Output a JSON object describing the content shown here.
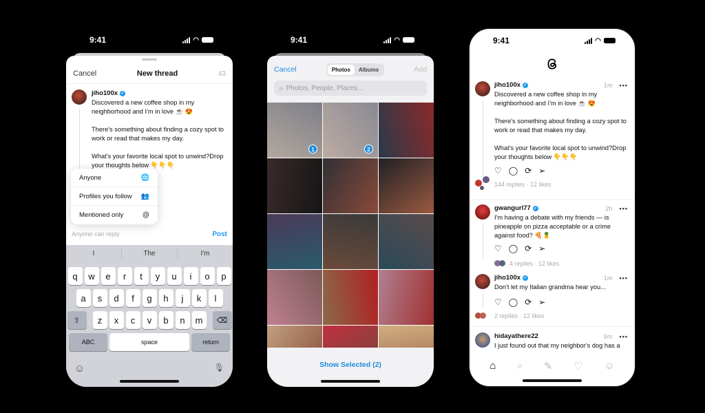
{
  "status": {
    "time": "9:41"
  },
  "composer": {
    "cancel": "Cancel",
    "title": "New thread",
    "char_count": "43",
    "username": "jiho100x",
    "verified": "✓",
    "text": "Discovered a new coffee shop in my neighborhood and I'm in love ☕ 😍\n\nThere's something about finding a cozy spot to work or read that makes my day.\n\nWhat's your favorite local spot to unwind?Drop your thoughts below 👇👇👇",
    "reply_menu": [
      {
        "label": "Anyone",
        "icon": "globe-icon",
        "glyph": "🌐"
      },
      {
        "label": "Profiles you follow",
        "icon": "people-icon",
        "glyph": "👥"
      },
      {
        "label": "Mentioned only",
        "icon": "at-icon",
        "glyph": "@"
      }
    ],
    "reply_setting": "Anyone can reply",
    "post": "Post"
  },
  "keyboard": {
    "suggestions": [
      "I",
      "The",
      "I'm"
    ],
    "row1": [
      "q",
      "w",
      "e",
      "r",
      "t",
      "y",
      "u",
      "i",
      "o",
      "p"
    ],
    "row2": [
      "a",
      "s",
      "d",
      "f",
      "g",
      "h",
      "j",
      "k",
      "l"
    ],
    "row3": [
      "z",
      "x",
      "c",
      "v",
      "b",
      "n",
      "m"
    ],
    "shift": "⇧",
    "backspace": "⌫",
    "abc": "ABC",
    "space": "space",
    "return": "return",
    "emoji": "☺",
    "mic": "🎙"
  },
  "picker": {
    "cancel": "Cancel",
    "tabs": [
      "Photos",
      "Albums"
    ],
    "active_tab": "Photos",
    "add": "Add",
    "search_placeholder": "Photos, People, Places...",
    "search_icon": "⌕",
    "selected_badges": [
      "1",
      "2"
    ],
    "show_selected": "Show Selected (2)"
  },
  "feed": {
    "posts": [
      {
        "username": "jiho100x",
        "verified": true,
        "time": "1m",
        "more": "•••",
        "text": "Discovered a new coffee shop in my neighborhood and I'm in love ☕ 😍\n\nThere's something about finding a cozy spot to work or read that makes my day.\n\nWhat's your favorite local spot to unwind?Drop your thoughts below 👇👇👇",
        "stats": "144 replies · 12 likes"
      },
      {
        "username": "gwangurl77",
        "verified": true,
        "time": "2h",
        "more": "•••",
        "text": "I'm having a debate with my friends — is pineapple on pizza acceptable or a crime against food? 🍕🍍",
        "stats": "4 replies · 12 likes"
      },
      {
        "username": "jiho100x",
        "verified": true,
        "time": "1m",
        "more": "•••",
        "text": "Don't let my Italian grandma hear you...",
        "stats": "2 replies · 12 likes"
      },
      {
        "username": "hidayathere22",
        "verified": false,
        "time": "6m",
        "more": "•••",
        "text": "I just found out that my neighbor's dog has a"
      }
    ],
    "actions": {
      "like": "♡",
      "reply": "◯",
      "repost": "⟳",
      "share": "➢"
    },
    "tabs": [
      {
        "name": "home",
        "glyph": "⌂",
        "active": true
      },
      {
        "name": "search",
        "glyph": "⌕"
      },
      {
        "name": "compose",
        "glyph": "✎"
      },
      {
        "name": "activity",
        "glyph": "♡"
      },
      {
        "name": "profile",
        "glyph": "☺"
      }
    ]
  }
}
